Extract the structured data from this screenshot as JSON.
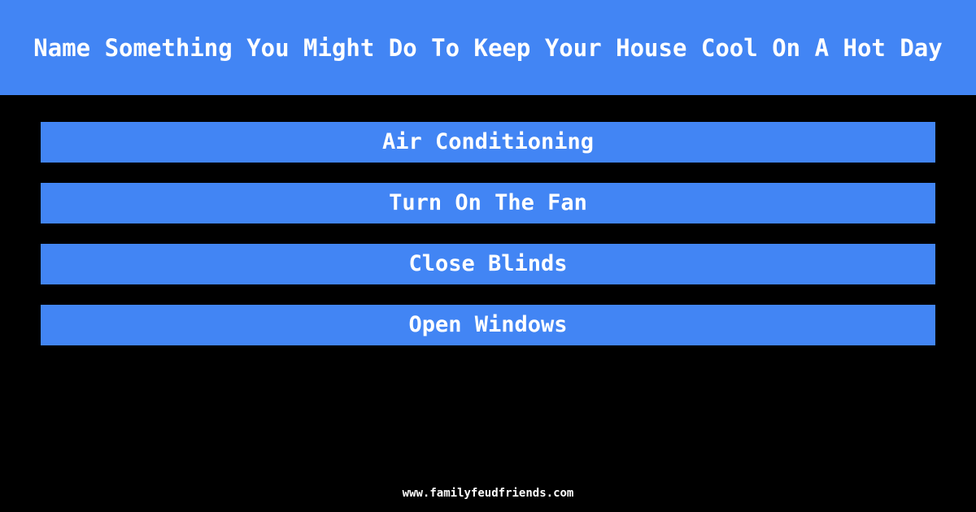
{
  "header": {
    "question": "Name Something You Might Do To Keep Your House Cool On A Hot Day",
    "background_color": "#4285F4",
    "text_color": "#FFFFFF"
  },
  "board": {
    "background_color": "#000000",
    "answer_color": "#4285F4",
    "answer_text_color": "#FFFFFF",
    "answers": [
      {
        "rank": 1,
        "text": "Air Conditioning"
      },
      {
        "rank": 2,
        "text": "Turn On The Fan"
      },
      {
        "rank": 3,
        "text": "Close Blinds"
      },
      {
        "rank": 4,
        "text": "Open Windows"
      }
    ]
  },
  "footer": {
    "site": "www.familyfeudfriends.com"
  }
}
